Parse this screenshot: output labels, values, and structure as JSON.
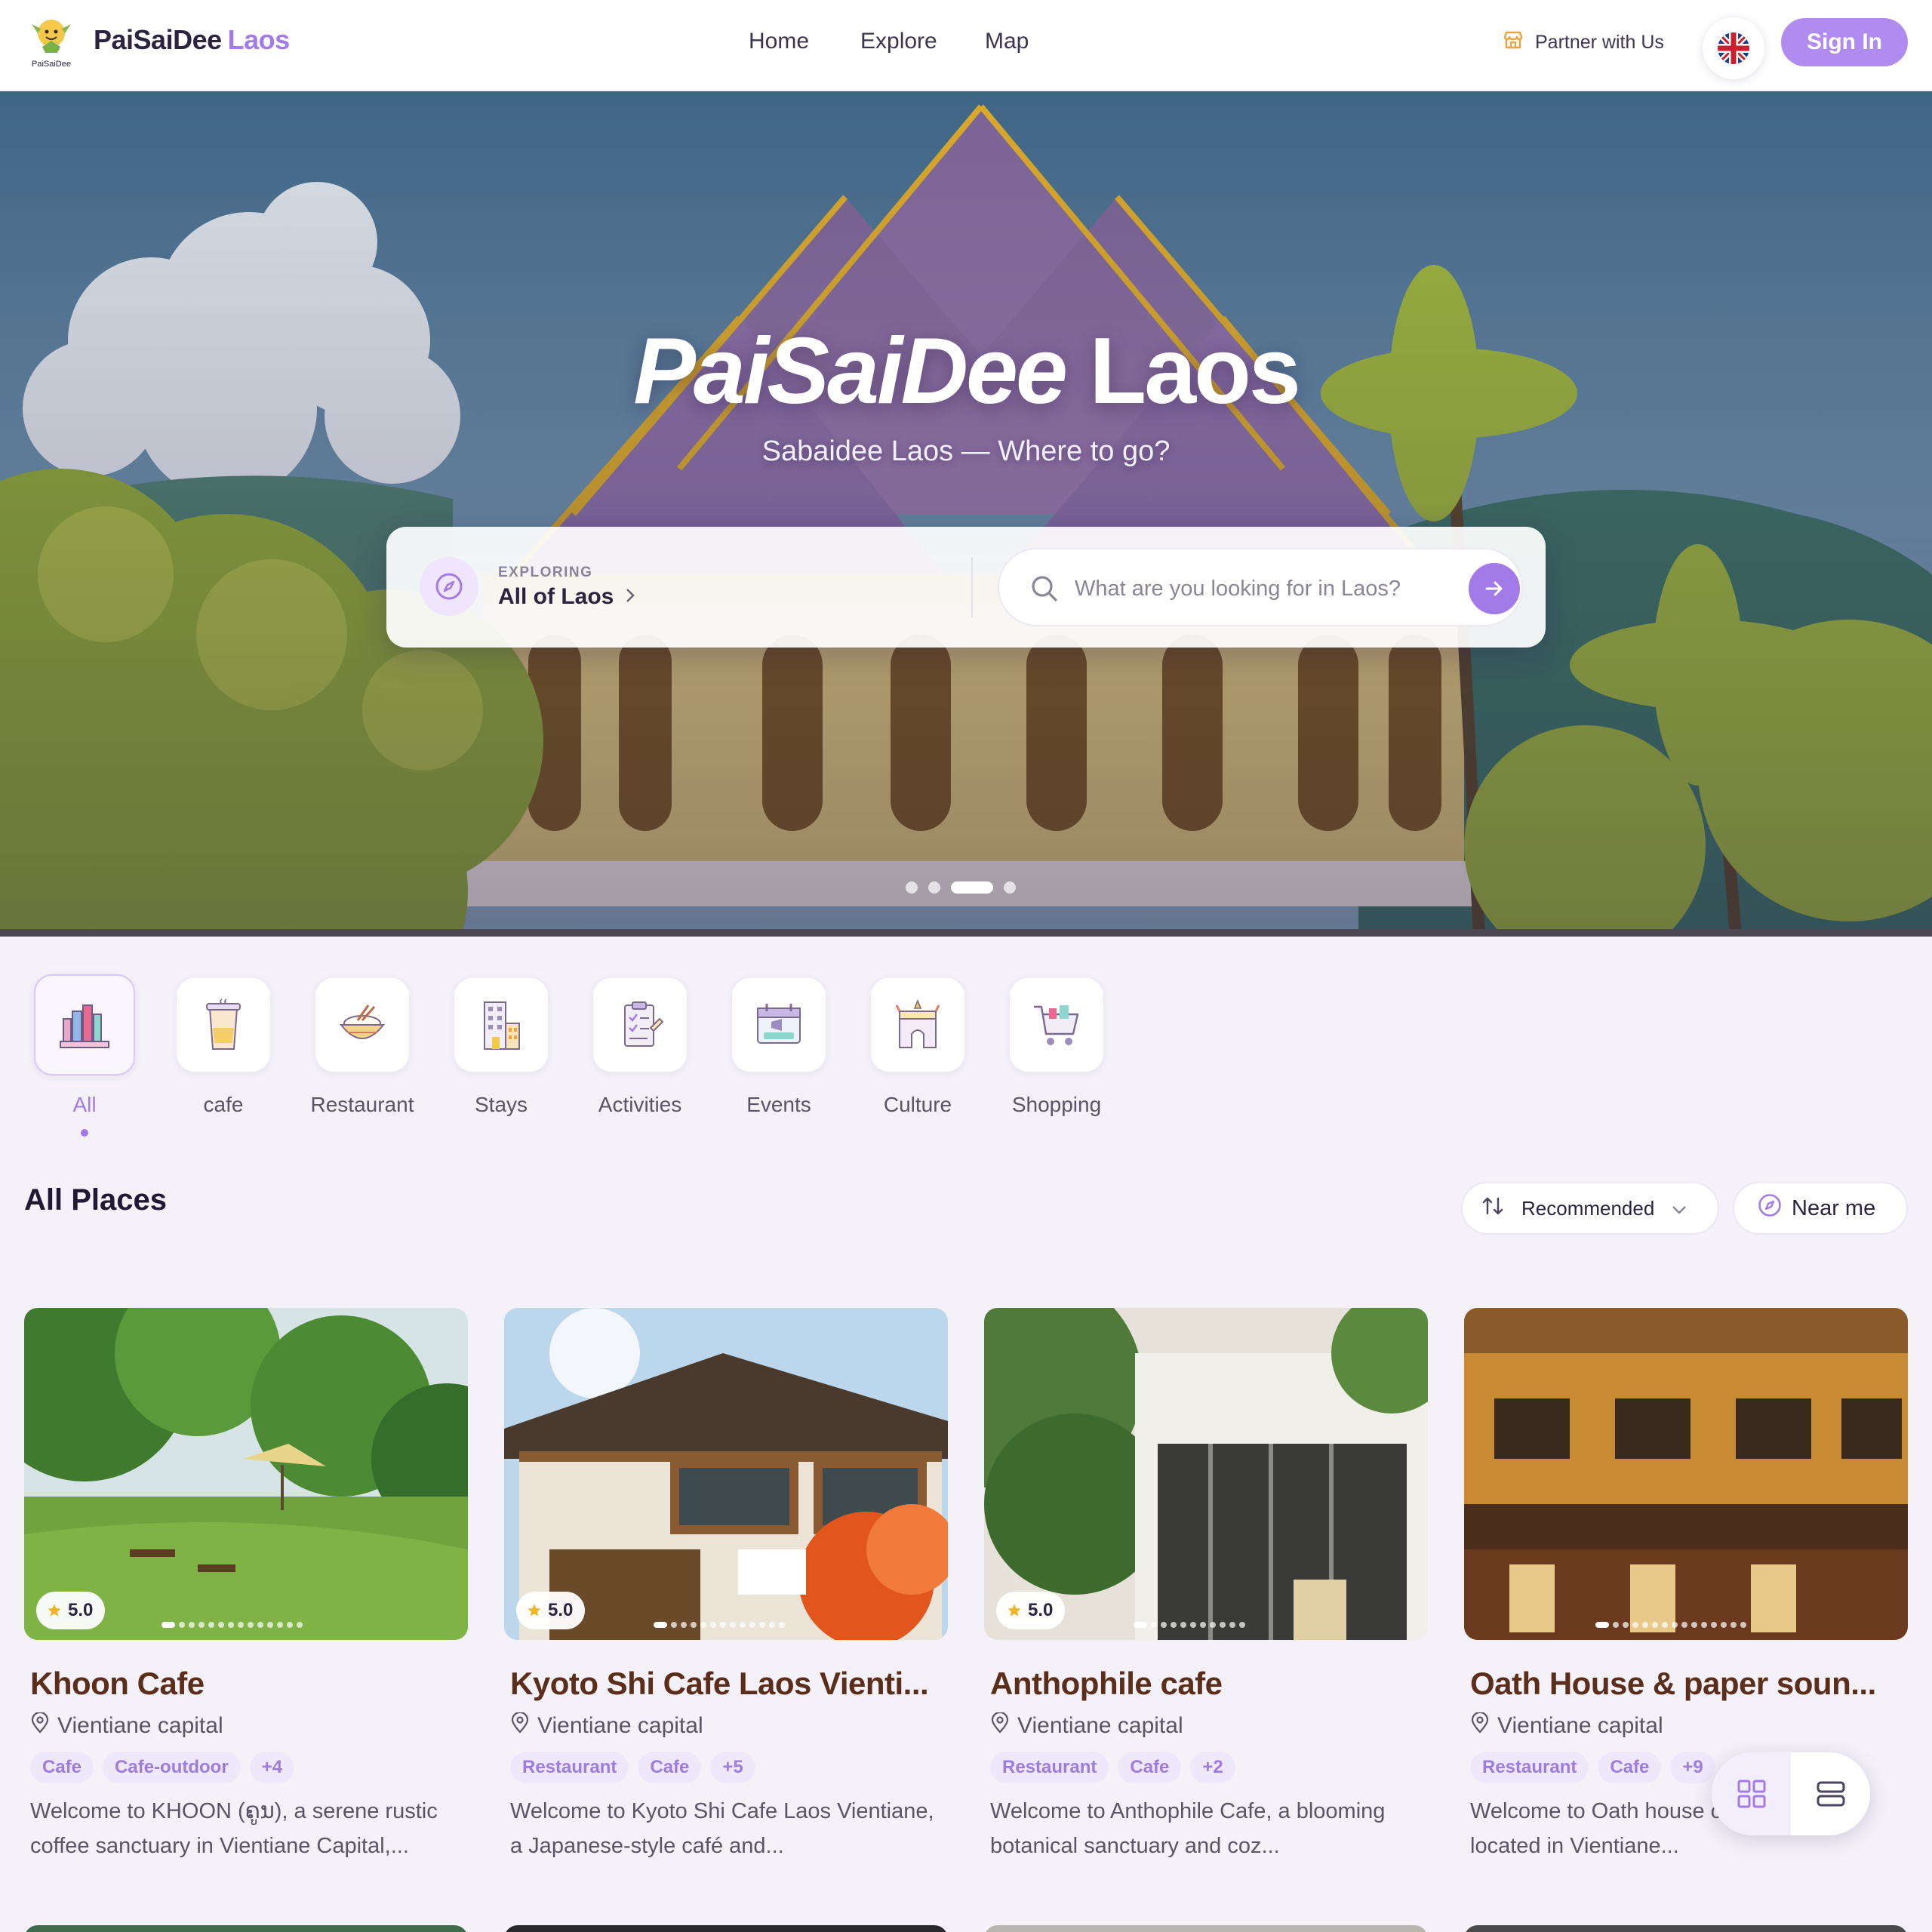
{
  "header": {
    "brand_main": "PaiSaiDee",
    "brand_accent": "Laos",
    "logo_caption": "PaiSaiDee",
    "nav": [
      "Home",
      "Explore",
      "Map"
    ],
    "partner": "Partner with Us",
    "language_icon": "uk-flag-icon",
    "signin": "Sign In"
  },
  "hero": {
    "title_main": "PaiSaiDee",
    "title_accent": "Laos",
    "subtitle": "Sabaidee Laos — Where to go?",
    "exploring_label": "EXPLORING",
    "exploring_value": "All of Laos",
    "search_placeholder": "What are you looking for in Laos?",
    "slides": 4,
    "active_slide": 3
  },
  "categories": [
    {
      "label": "All",
      "active": true
    },
    {
      "label": "cafe"
    },
    {
      "label": "Restaurant"
    },
    {
      "label": "Stays"
    },
    {
      "label": "Activities"
    },
    {
      "label": "Events"
    },
    {
      "label": "Culture"
    },
    {
      "label": "Shopping"
    }
  ],
  "section": {
    "title": "All Places",
    "sort_label": "Recommended",
    "near_label": "Near me"
  },
  "places": [
    {
      "title": "Khoon Cafe",
      "location": "Vientiane capital",
      "rating": "5.0",
      "tags": [
        "Cafe",
        "Cafe-outdoor",
        "+4"
      ],
      "description": "Welcome to KHOON (ຄູນ), a serene rustic coffee sanctuary in Vientiane Capital,..."
    },
    {
      "title": "Kyoto Shi Cafe Laos Vienti...",
      "location": "Vientiane capital",
      "rating": "5.0",
      "tags": [
        "Restaurant",
        "Cafe",
        "+5"
      ],
      "description": "Welcome to Kyoto Shi Cafe Laos Vientiane, a Japanese-style café and..."
    },
    {
      "title": "Anthophile cafe",
      "location": "Vientiane capital",
      "rating": "5.0",
      "tags": [
        "Restaurant",
        "Cafe",
        "+2"
      ],
      "description": "Welcome to Anthophile Cafe, a blooming botanical sanctuary and coz..."
    },
    {
      "title": "Oath House & paper soun...",
      "location": "Vientiane capital",
      "rating": "",
      "tags": [
        "Restaurant",
        "Cafe",
        "+9"
      ],
      "description": "Welcome to Oath house cafe hideaway located in Vientiane..."
    }
  ],
  "colors": {
    "accent": "#a37be8",
    "signin_bg": "#b08cf0",
    "page_bg": "#f4f1f9",
    "card_title": "#5a2e1a",
    "partner_icon": "#f0a13b"
  }
}
